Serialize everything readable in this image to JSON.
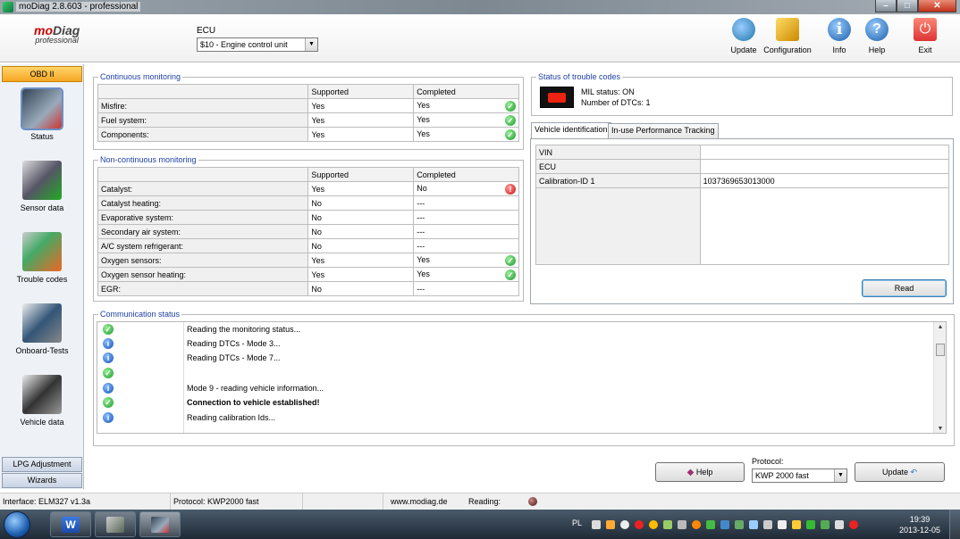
{
  "window": {
    "title": "moDiag 2.8.603 - professional"
  },
  "logo": {
    "mo": "mo",
    "diag": "Diag",
    "sub": "professional"
  },
  "ecu": {
    "label": "ECU",
    "selected": "$10 - Engine control unit"
  },
  "toolbar": {
    "update": "Update",
    "configuration": "Configuration",
    "info": "Info",
    "help": "Help",
    "exit": "Exit"
  },
  "nav": {
    "header": "OBD II",
    "items": [
      {
        "label": "Status",
        "icon": "status-icon"
      },
      {
        "label": "Sensor data",
        "icon": "sensor-data-icon"
      },
      {
        "label": "Trouble codes",
        "icon": "trouble-codes-icon"
      },
      {
        "label": "Onboard-Tests",
        "icon": "onboard-tests-icon"
      },
      {
        "label": "Vehicle data",
        "icon": "vehicle-data-icon"
      }
    ],
    "footer": [
      "LPG Adjustment",
      "Wizards"
    ]
  },
  "continuous": {
    "title": "Continuous monitoring",
    "headers": [
      "",
      "Supported",
      "Completed"
    ],
    "rows": [
      {
        "name": "Misfire:",
        "supported": "Yes",
        "completed": "Yes",
        "status": "ok"
      },
      {
        "name": "Fuel system:",
        "supported": "Yes",
        "completed": "Yes",
        "status": "ok"
      },
      {
        "name": "Components:",
        "supported": "Yes",
        "completed": "Yes",
        "status": "ok"
      }
    ]
  },
  "noncontinuous": {
    "title": "Non-continuous monitoring",
    "headers": [
      "",
      "Supported",
      "Completed"
    ],
    "rows": [
      {
        "name": "Catalyst:",
        "supported": "Yes",
        "completed": "No",
        "status": "err"
      },
      {
        "name": "Catalyst heating:",
        "supported": "No",
        "completed": "---",
        "status": ""
      },
      {
        "name": "Evaporative system:",
        "supported": "No",
        "completed": "---",
        "status": ""
      },
      {
        "name": "Secondary air system:",
        "supported": "No",
        "completed": "---",
        "status": ""
      },
      {
        "name": "A/C system refrigerant:",
        "supported": "No",
        "completed": "---",
        "status": ""
      },
      {
        "name": "Oxygen sensors:",
        "supported": "Yes",
        "completed": "Yes",
        "status": "ok"
      },
      {
        "name": "Oxygen sensor heating:",
        "supported": "Yes",
        "completed": "Yes",
        "status": "ok"
      },
      {
        "name": "EGR:",
        "supported": "No",
        "completed": "---",
        "status": ""
      }
    ]
  },
  "trouble": {
    "title": "Status of trouble codes",
    "mil_status": "MIL status: ON",
    "dtc_count": "Number of DTCs: 1"
  },
  "tabs": [
    "Vehicle identification",
    "In-use Performance Tracking"
  ],
  "vehicle_id": {
    "rows": [
      {
        "label": "VIN",
        "value": ""
      },
      {
        "label": "ECU",
        "value": ""
      },
      {
        "label": "Calibration-ID 1",
        "value": "1037369653013000"
      }
    ],
    "read_button": "Read"
  },
  "communication": {
    "title": "Communication status",
    "rows": [
      {
        "icon": "ok",
        "text": "Reading the monitoring status...",
        "bold": false
      },
      {
        "icon": "info",
        "text": "Reading DTCs - Mode 3...",
        "bold": false
      },
      {
        "icon": "info",
        "text": "Reading DTCs - Mode 7...",
        "bold": false
      },
      {
        "icon": "ok",
        "text": "",
        "bold": false
      },
      {
        "icon": "info",
        "text": "Mode 9 - reading vehicle information...",
        "bold": false
      },
      {
        "icon": "ok",
        "text": "Connection to vehicle established!",
        "bold": true
      },
      {
        "icon": "info",
        "text": "Reading calibration Ids...",
        "bold": false
      }
    ]
  },
  "bottom": {
    "help_button": "Help",
    "protocol_label": "Protocol:",
    "protocol_value": "KWP 2000 fast",
    "update_button": "Update"
  },
  "statusbar": {
    "interface": "Interface: ELM327 v1.3a",
    "protocol": "Protocol: KWP2000 fast",
    "website": "www.modiag.de",
    "reading": "Reading:"
  },
  "taskbar": {
    "lang": "PL",
    "time": "19:39",
    "date": "2013-12-05"
  },
  "colors": {
    "accent_orange": "#f5a623",
    "group_title": "#1f3fa3",
    "ok_green": "#1a9a2a",
    "error_red": "#cc1111",
    "info_blue": "#1454b8"
  }
}
